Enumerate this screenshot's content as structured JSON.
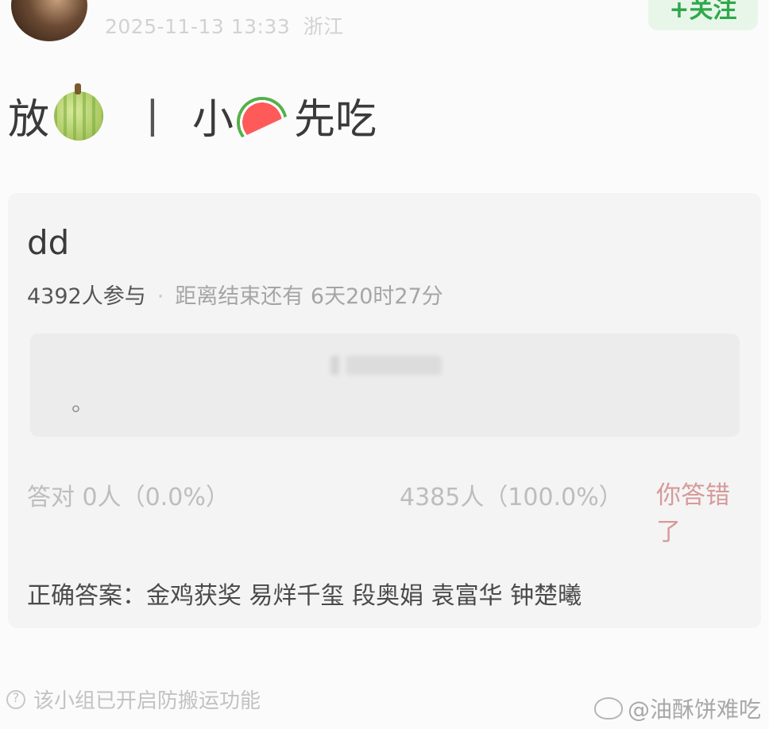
{
  "header": {
    "timestamp": "2025-11-13 13:33",
    "location": "浙江",
    "follow_label": "+关注"
  },
  "post": {
    "title_part1": "放",
    "title_sep": "丨",
    "title_part2": "小",
    "title_part3": "先吃",
    "emoji_1": "melon-emoji",
    "emoji_2": "watermelon-emoji"
  },
  "poll": {
    "title": "dd",
    "participants": "4392人参与",
    "countdown": "距离结束还有 6天20时27分",
    "option_text": "。",
    "correct_stat": "答对  0人（0.0%）",
    "wrong_stat": "4385人（100.0%）",
    "wrong_tag": "你答错了",
    "answer": "正确答案：金鸡获奖 易烊千玺 段奥娟 袁富华 钟楚曦"
  },
  "footer": {
    "note": "该小组已开启防搬运功能",
    "watermark": "@油酥饼难吃"
  }
}
